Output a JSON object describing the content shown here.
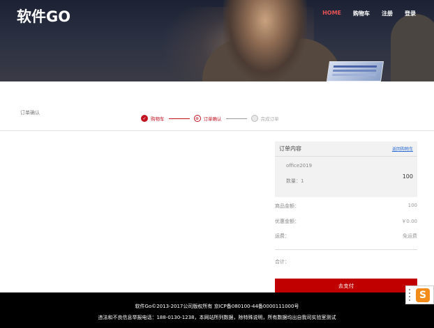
{
  "header": {
    "logo": "软件GO",
    "nav": [
      {
        "label": "HOME",
        "active": true
      },
      {
        "label": "购物车",
        "active": false
      },
      {
        "label": "注册",
        "active": false
      },
      {
        "label": "登录",
        "active": false
      }
    ]
  },
  "page": {
    "title": "订单确认",
    "steps": [
      {
        "label": "购物车",
        "state": "done",
        "mark": "✓"
      },
      {
        "label": "订单确认",
        "state": "current",
        "mark": "⊗"
      },
      {
        "label": "完成订单",
        "state": "todo",
        "mark": ""
      }
    ]
  },
  "order": {
    "heading": "订单内容",
    "back_link": "返回购物车",
    "product_name": "office2019",
    "quantity_label": "数量：1",
    "price": "100",
    "rows": [
      {
        "label": "商品金额：",
        "value": "100"
      },
      {
        "label": "优惠金额：",
        "value": "￥0.00"
      },
      {
        "label": "运费：",
        "value": "免运费"
      }
    ],
    "total_label": "合计：",
    "total_value": "",
    "pay_button": "去支付"
  },
  "footer": {
    "line1": "软件Go©2013-2017公司版权所有 京ICP备080100-44备0000111000号",
    "line2": "违法和不良信息举报电话：188-0130-1238，本网站所列数据，除特殊说明，所有数据均出自我司实验室测试"
  },
  "colors": {
    "accent": "#c00000",
    "nav_active": "#e65357",
    "link": "#2b6bd6"
  }
}
